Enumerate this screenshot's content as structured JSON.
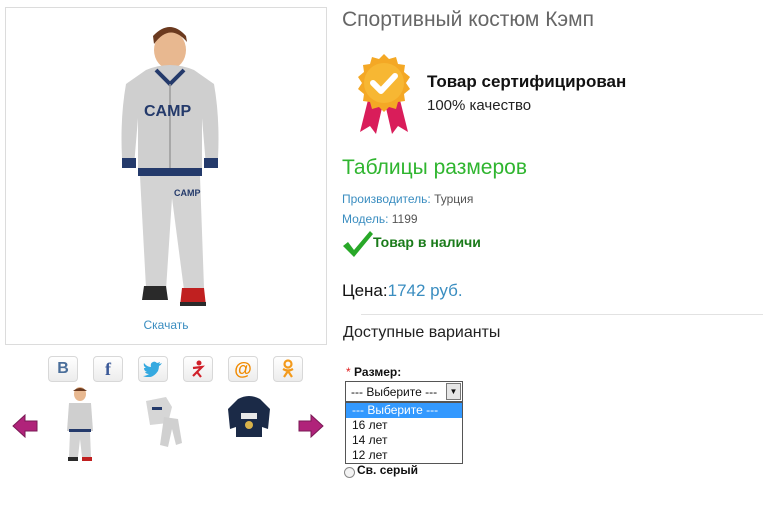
{
  "product": {
    "title": "Спортивный костюм Кэмп",
    "download_link": "Скачать",
    "image_alt": "CAMP"
  },
  "certificate": {
    "title": "Товар сертифицирован",
    "subtitle": "100% качество"
  },
  "size_tables_link": "Таблицы размеров",
  "meta": {
    "manufacturer_label": "Производитель:",
    "manufacturer_value": "Турция",
    "model_label": "Модель:",
    "model_value": "1199"
  },
  "stock_status": "Товар в наличи",
  "price": {
    "label": "Цена:",
    "value": "1742 руб."
  },
  "options": {
    "heading": "Доступные варианты",
    "size_label": "Размер:",
    "required_mark": "*",
    "selected": "--- Выберите ---",
    "dropdown_items": [
      "--- Выберите ---",
      "16 лет",
      "14 лет",
      "12 лет"
    ],
    "color_label": "Св. серый"
  },
  "share": {
    "vk": "В",
    "facebook": "f",
    "twitter": "twitter-icon",
    "moimir": "moimir-icon",
    "mail": "@",
    "odnoklassniki": "odnoklassniki-icon"
  },
  "colors": {
    "accent_blue": "#3a8dc0",
    "green_link": "#2fb52f",
    "stock_green": "#1a7b1a",
    "arrow_purple": "#b0237a"
  }
}
